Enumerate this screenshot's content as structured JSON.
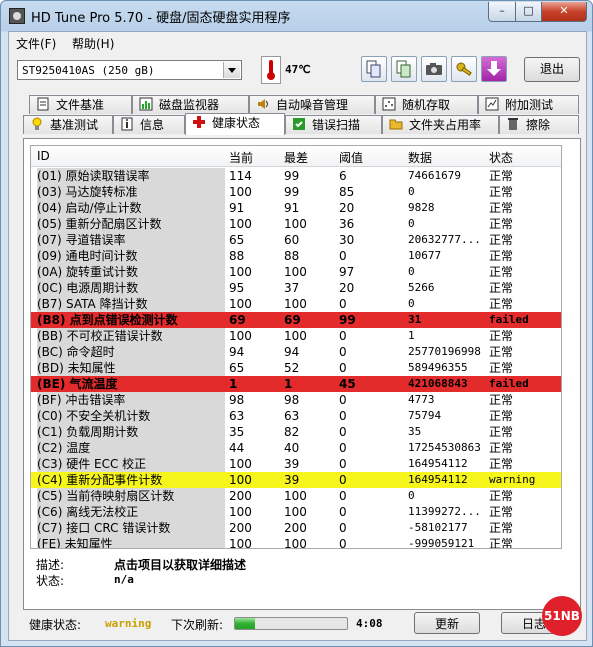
{
  "window": {
    "title": "HD Tune Pro 5.70 - 硬盘/固态硬盘实用程序",
    "min": "–",
    "max": "□",
    "close": "✕"
  },
  "menu": [
    {
      "label": "文件(F)"
    },
    {
      "label": "帮助(H)"
    }
  ],
  "toolbar": {
    "drive": "ST9250410AS (250 gB)",
    "temperature": "47℃",
    "exit_label": "退出"
  },
  "tabs_top": [
    {
      "label": "文件基准",
      "icon": "file-benchmark-icon"
    },
    {
      "label": "磁盘监视器",
      "icon": "disk-monitor-icon"
    },
    {
      "label": "自动噪音管理",
      "icon": "speaker-icon"
    },
    {
      "label": "随机存取",
      "icon": "random-access-icon"
    },
    {
      "label": "附加测试",
      "icon": "extra-tests-icon"
    }
  ],
  "tabs_bottom": [
    {
      "label": "基准测试",
      "icon": "benchmark-icon"
    },
    {
      "label": "信息",
      "icon": "info-icon"
    },
    {
      "label": "健康状态",
      "icon": "health-cross-icon",
      "active": true
    },
    {
      "label": "错误扫描",
      "icon": "error-scan-icon"
    },
    {
      "label": "文件夹占用率",
      "icon": "folder-icon"
    },
    {
      "label": "擦除",
      "icon": "erase-icon"
    }
  ],
  "table": {
    "headers": [
      "ID",
      "当前",
      "最差",
      "阈值",
      "数据",
      "状态"
    ],
    "rows": [
      {
        "id": "(01) 原始读取错误率",
        "cur": "114",
        "worst": "99",
        "thr": "6",
        "data": "74661679",
        "status": "正常",
        "hl": ""
      },
      {
        "id": "(03) 马达旋转标准",
        "cur": "100",
        "worst": "99",
        "thr": "85",
        "data": "0",
        "status": "正常",
        "hl": ""
      },
      {
        "id": "(04) 启动/停止计数",
        "cur": "91",
        "worst": "91",
        "thr": "20",
        "data": "9828",
        "status": "正常",
        "hl": ""
      },
      {
        "id": "(05) 重新分配扇区计数",
        "cur": "100",
        "worst": "100",
        "thr": "36",
        "data": "0",
        "status": "正常",
        "hl": ""
      },
      {
        "id": "(07) 寻道错误率",
        "cur": "65",
        "worst": "60",
        "thr": "30",
        "data": "20632777...",
        "status": "正常",
        "hl": ""
      },
      {
        "id": "(09) 通电时间计数",
        "cur": "88",
        "worst": "88",
        "thr": "0",
        "data": "10677",
        "status": "正常",
        "hl": ""
      },
      {
        "id": "(0A) 旋转重试计数",
        "cur": "100",
        "worst": "100",
        "thr": "97",
        "data": "0",
        "status": "正常",
        "hl": ""
      },
      {
        "id": "(0C) 电源周期计数",
        "cur": "95",
        "worst": "37",
        "thr": "20",
        "data": "5266",
        "status": "正常",
        "hl": ""
      },
      {
        "id": "(B7) SATA 降挡计数",
        "cur": "100",
        "worst": "100",
        "thr": "0",
        "data": "0",
        "status": "正常",
        "hl": ""
      },
      {
        "id": "(B8) 点到点错误检测计数",
        "cur": "69",
        "worst": "69",
        "thr": "99",
        "data": "31",
        "status": "failed",
        "hl": "red"
      },
      {
        "id": "(BB) 不可校正错误计数",
        "cur": "100",
        "worst": "100",
        "thr": "0",
        "data": "1",
        "status": "正常",
        "hl": ""
      },
      {
        "id": "(BC) 命令超时",
        "cur": "94",
        "worst": "94",
        "thr": "0",
        "data": "25770196998",
        "status": "正常",
        "hl": ""
      },
      {
        "id": "(BD) 未知属性",
        "cur": "65",
        "worst": "52",
        "thr": "0",
        "data": "589496355",
        "status": "正常",
        "hl": ""
      },
      {
        "id": "(BE) 气流温度",
        "cur": "1",
        "worst": "1",
        "thr": "45",
        "data": "421068843",
        "status": "failed",
        "hl": "red"
      },
      {
        "id": "(BF) 冲击错误率",
        "cur": "98",
        "worst": "98",
        "thr": "0",
        "data": "4773",
        "status": "正常",
        "hl": ""
      },
      {
        "id": "(C0) 不安全关机计数",
        "cur": "63",
        "worst": "63",
        "thr": "0",
        "data": "75794",
        "status": "正常",
        "hl": ""
      },
      {
        "id": "(C1) 负载周期计数",
        "cur": "35",
        "worst": "82",
        "thr": "0",
        "data": "35",
        "status": "正常",
        "hl": ""
      },
      {
        "id": "(C2) 温度",
        "cur": "44",
        "worst": "40",
        "thr": "0",
        "data": "17254530863",
        "status": "正常",
        "hl": ""
      },
      {
        "id": "(C3) 硬件 ECC 校正",
        "cur": "100",
        "worst": "39",
        "thr": "0",
        "data": "164954112",
        "status": "正常",
        "hl": ""
      },
      {
        "id": "(C4) 重新分配事件计数",
        "cur": "100",
        "worst": "39",
        "thr": "0",
        "data": "164954112",
        "status": "warning",
        "hl": "yellow"
      },
      {
        "id": "(C5) 当前待映射扇区计数",
        "cur": "200",
        "worst": "100",
        "thr": "0",
        "data": "0",
        "status": "正常",
        "hl": ""
      },
      {
        "id": "(C6) 离线无法校正",
        "cur": "100",
        "worst": "100",
        "thr": "0",
        "data": "11399272...",
        "status": "正常",
        "hl": ""
      },
      {
        "id": "(C7) 接口 CRC 错误计数",
        "cur": "200",
        "worst": "200",
        "thr": "0",
        "data": "-58102177",
        "status": "正常",
        "hl": ""
      },
      {
        "id": "(FE) 未知属性",
        "cur": "100",
        "worst": "100",
        "thr": "0",
        "data": "-999059121",
        "status": "正常",
        "hl": ""
      }
    ]
  },
  "details": {
    "desc_label": "描述:",
    "desc_value": "点击项目以获取详细描述",
    "status_label": "状态:",
    "status_value": "n/a"
  },
  "statusbar": {
    "health_label": "健康状态:",
    "health_value": "warning",
    "refresh_label": "下次刷新:",
    "refresh_progress": 0.18,
    "countdown": "4:08",
    "refresh_button": "更新",
    "log_button": "日志"
  },
  "watermark": "51NB",
  "colors": {
    "failed_row": "#e32b2b",
    "warning_row": "#f6f61c",
    "warning_text": "#c8a000"
  }
}
